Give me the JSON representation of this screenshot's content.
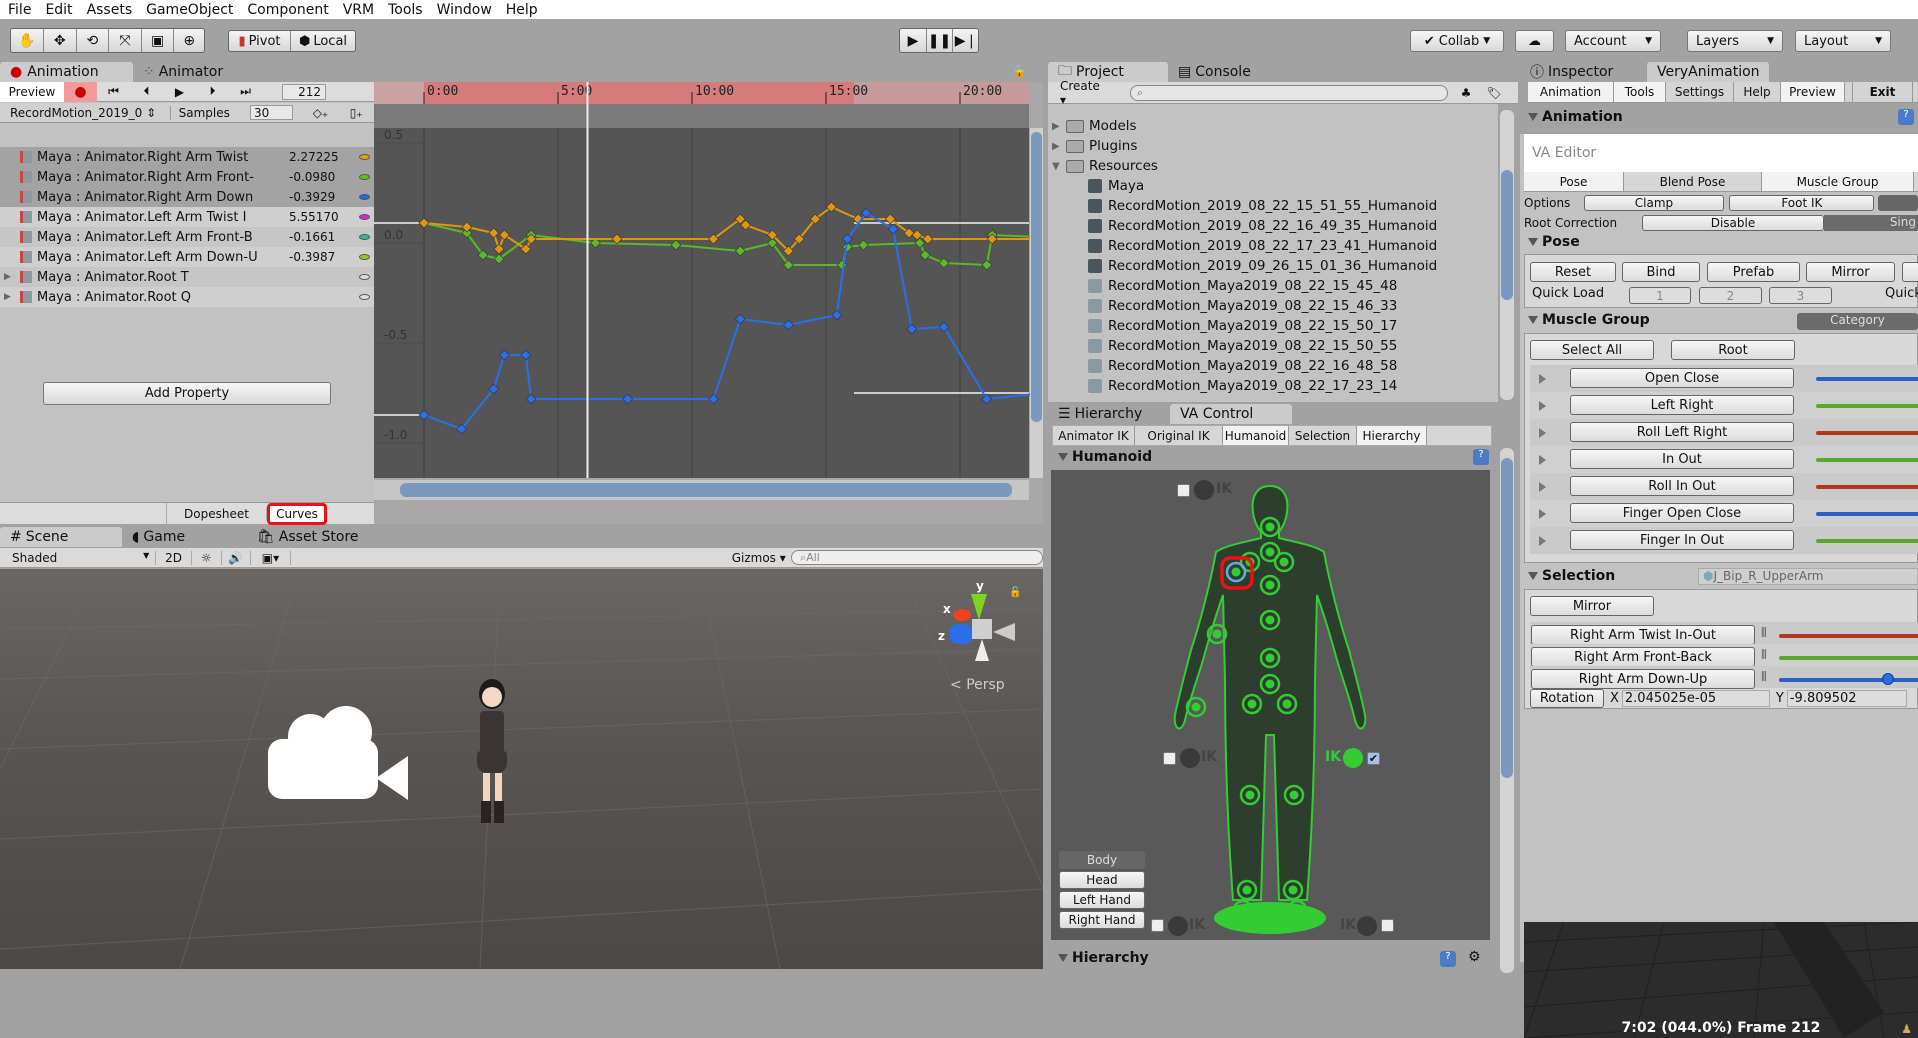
{
  "menu": [
    "File",
    "Edit",
    "Assets",
    "GameObject",
    "Component",
    "VRM",
    "Tools",
    "Window",
    "Help"
  ],
  "toolbar": {
    "tools": [
      "hand-tool",
      "move-tool",
      "rotate-tool",
      "scale-tool",
      "rect-tool",
      "transform-tool"
    ],
    "pivot": "Pivot",
    "local": "Local",
    "collab": "Collab",
    "account": "Account",
    "layers": "Layers",
    "layout": "Layout"
  },
  "animation": {
    "tabs": [
      "Animation",
      "Animator"
    ],
    "preview": "Preview",
    "frame": "212",
    "clip": "RecordMotion_2019_0",
    "samples_label": "Samples",
    "samples": "30",
    "properties": [
      {
        "name": "Maya : Animator.Right Arm Twist",
        "value": "2.27225",
        "color": "#e8a000"
      },
      {
        "name": "Maya : Animator.Right Arm Front-",
        "value": "-0.0980",
        "color": "#5ec21a"
      },
      {
        "name": "Maya : Animator.Right Arm Down",
        "value": "-0.3929",
        "color": "#1a6ce8"
      },
      {
        "name": "Maya : Animator.Left Arm Twist I",
        "value": "5.55170",
        "color": "#e020e0"
      },
      {
        "name": "Maya : Animator.Left Arm Front-B",
        "value": "-0.1661",
        "color": "#20c0a0"
      },
      {
        "name": "Maya : Animator.Left Arm Down-U",
        "value": "-0.3987",
        "color": "#9ac81a"
      },
      {
        "name": "Maya : Animator.Root T",
        "value": "",
        "color": "#dddddd"
      },
      {
        "name": "Maya : Animator.Root Q",
        "value": "",
        "color": "#dddddd"
      }
    ],
    "add_property": "Add Property",
    "mode_tabs": [
      "Dopesheet",
      "Curves"
    ],
    "timeline_ticks": [
      "0:00",
      "5:00",
      "10:00",
      "15:00",
      "20:00"
    ],
    "y_ticks": [
      "0.5",
      "0.0",
      "-0.5",
      "-1.0"
    ]
  },
  "scene": {
    "tabs": [
      "Scene",
      "Game",
      "Asset Store"
    ],
    "shading": "Shaded",
    "mode2d": "2D",
    "gizmos": "Gizmos",
    "search_placeholder": "All",
    "persp": "Persp",
    "axes": [
      "x",
      "y",
      "z"
    ]
  },
  "project": {
    "tabs": [
      "Project",
      "Console"
    ],
    "create": "Create",
    "items": [
      {
        "name": "Models",
        "type": "folder",
        "indent": 0
      },
      {
        "name": "Plugins",
        "type": "folder",
        "indent": 0
      },
      {
        "name": "Resources",
        "type": "folder",
        "indent": 0,
        "open": true
      },
      {
        "name": "Maya",
        "type": "avatar",
        "indent": 1
      },
      {
        "name": "RecordMotion_2019_08_22_15_51_55_Humanoid",
        "type": "anim",
        "indent": 1
      },
      {
        "name": "RecordMotion_2019_08_22_16_49_35_Humanoid",
        "type": "anim",
        "indent": 1
      },
      {
        "name": "RecordMotion_2019_08_22_17_23_41_Humanoid",
        "type": "anim",
        "indent": 1
      },
      {
        "name": "RecordMotion_2019_09_26_15_01_36_Humanoid",
        "type": "anim",
        "indent": 1
      },
      {
        "name": "RecordMotion_Maya2019_08_22_15_45_48",
        "type": "unity",
        "indent": 1
      },
      {
        "name": "RecordMotion_Maya2019_08_22_15_46_33",
        "type": "unity",
        "indent": 1
      },
      {
        "name": "RecordMotion_Maya2019_08_22_15_50_17",
        "type": "unity",
        "indent": 1
      },
      {
        "name": "RecordMotion_Maya2019_08_22_15_50_55",
        "type": "unity",
        "indent": 1
      },
      {
        "name": "RecordMotion_Maya2019_08_22_16_48_58",
        "type": "unity",
        "indent": 1
      },
      {
        "name": "RecordMotion_Maya2019_08_22_17_23_14",
        "type": "unity",
        "indent": 1
      }
    ]
  },
  "vacontrol": {
    "tabs": [
      "Hierarchy",
      "VA Control"
    ],
    "subtabs": [
      "Animator IK",
      "Original IK",
      "Humanoid",
      "Selection",
      "Hierarchy"
    ],
    "section": "Humanoid",
    "part_buttons": [
      "Body",
      "Head",
      "Left Hand",
      "Right Hand"
    ],
    "ik_label": "IK",
    "footer": "Hierarchy"
  },
  "inspector": {
    "tabs": [
      "Inspector",
      "VeryAnimation"
    ],
    "subtabs": [
      "Animation",
      "Tools",
      "Settings",
      "Help",
      "Preview",
      "Exit"
    ],
    "animation_header": "Animation",
    "editor_label": "VA Editor",
    "mode_tabs": [
      "Pose",
      "Blend Pose",
      "Muscle Group"
    ],
    "options_label": "Options",
    "options": [
      "Clamp",
      "Foot IK"
    ],
    "root_correction_label": "Root Correction",
    "root_correction": [
      "Disable",
      "Sing"
    ],
    "pose_header": "Pose",
    "pose_buttons": [
      "Reset",
      "Bind",
      "Prefab",
      "Mirror"
    ],
    "quick_load_label": "Quick Load",
    "quick_slots": [
      "1",
      "2",
      "3"
    ],
    "quick_save_label": "Quick",
    "muscle_header": "Muscle Group",
    "category": "Category",
    "select_all": "Select All",
    "root": "Root",
    "muscles": [
      {
        "label": "Open Close",
        "color": "#2a5fc4"
      },
      {
        "label": "Left Right",
        "color": "#5aa82a"
      },
      {
        "label": "Roll Left Right",
        "color": "#b03a20"
      },
      {
        "label": "In Out",
        "color": "#5aa82a"
      },
      {
        "label": "Roll In Out",
        "color": "#b03a20"
      },
      {
        "label": "Finger Open Close",
        "color": "#2a5fc4"
      },
      {
        "label": "Finger In Out",
        "color": "#5aa82a"
      }
    ],
    "selection_header": "Selection",
    "selection_object": "J_Bip_R_UpperArm",
    "mirror": "Mirror",
    "sel_muscles": [
      {
        "label": "Right Arm Twist In-Out",
        "color": "#b03a20"
      },
      {
        "label": "Right Arm Front-Back",
        "color": "#5aa82a"
      },
      {
        "label": "Right Arm Down-Up",
        "color": "#2a5fc4"
      }
    ],
    "rotation_label": "Rotation",
    "rot_x": "2.045025e-05",
    "rot_y": "-9.809502",
    "preview_status": "7:02 (044.0%) Frame 212"
  }
}
